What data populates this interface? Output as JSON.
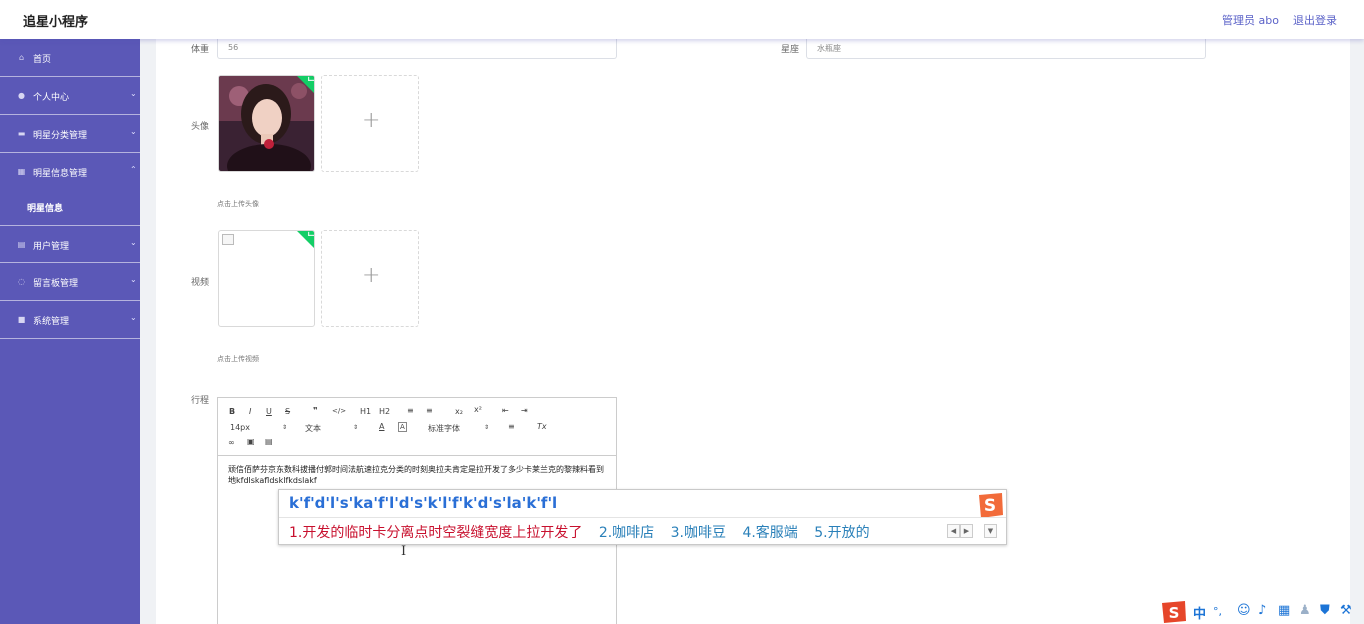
{
  "header": {
    "app_title": "追星小程序",
    "admin_label": "管理员 abo",
    "logout": "退出登录"
  },
  "sidebar": {
    "items": [
      {
        "label": "首页",
        "icon": "home-icon"
      },
      {
        "label": "个人中心",
        "icon": "user-icon"
      },
      {
        "label": "明星分类管理",
        "icon": "category-icon"
      },
      {
        "label": "明星信息管理",
        "icon": "grid-icon",
        "expanded": true
      },
      {
        "label": "用户管理",
        "icon": "users-icon"
      },
      {
        "label": "留言板管理",
        "icon": "message-icon"
      },
      {
        "label": "系统管理",
        "icon": "system-icon"
      }
    ],
    "sub_item": "明星信息"
  },
  "form": {
    "weight": {
      "label": "体重",
      "value": "56"
    },
    "constellation": {
      "label": "星座",
      "value": "水瓶座"
    },
    "avatar": {
      "label": "头像",
      "hint": "点击上传头像"
    },
    "video": {
      "label": "视频",
      "hint": "点击上传视频"
    },
    "itinerary": {
      "label": "行程"
    }
  },
  "editor": {
    "toolbar": {
      "bold": "B",
      "italic": "I",
      "underline": "U",
      "strike": "S",
      "quote": "❞",
      "code": "</>",
      "h1": "H1",
      "h2": "H2",
      "ol": "≡",
      "ul": "≡",
      "sub": "x₂",
      "sup": "x²",
      "outdent": "⇤",
      "indent": "⇥",
      "size": "14px",
      "paragraph": "文本",
      "font_color": "A",
      "bg_color": "A",
      "font": "标准字体",
      "align": "≡",
      "clean": "Tx",
      "link": "🔗",
      "image": "▣",
      "video": "▤"
    },
    "content": "顽信佰萨芬京东数科拔播付郭时间法航速拉克分类的时刻奥拉夫肯定是拉开发了多少卡莱兰克的黎辣料看到地kfdlskafldsklfkdslakf"
  },
  "ime": {
    "composition": "k'f'd'l's'ka'f'l'd's'k'l'f'k'd's'la'k'f'l",
    "candidates": [
      "1.开发的临时卡分离点时空裂缝宽度上拉开发了",
      "2.咖啡店",
      "3.咖啡豆",
      "4.客服端",
      "5.开放的"
    ],
    "prev": "◀",
    "next": "▶",
    "menu": "▼"
  },
  "tray": {
    "lang": "中",
    "punct": "°,"
  }
}
